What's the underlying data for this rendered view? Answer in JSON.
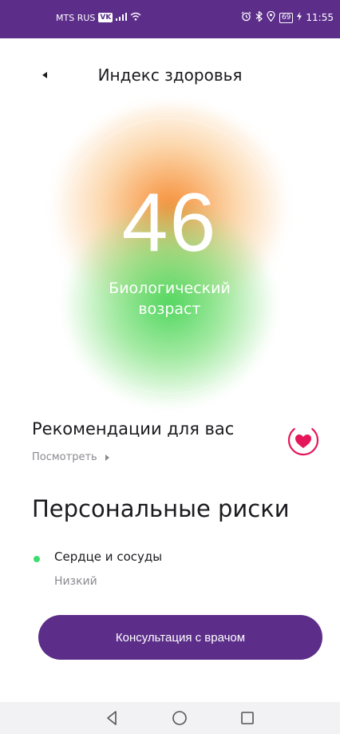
{
  "status_bar": {
    "carrier": "MTS RUS",
    "app_badge": "VK",
    "signal_icon": "signal-icon",
    "wifi_icon": "wifi-icon",
    "alarm_icon": "alarm-icon",
    "bluetooth_icon": "bluetooth-icon",
    "location_icon": "location-icon",
    "battery": "69",
    "time": "11:55"
  },
  "header": {
    "title": "Индекс здоровья",
    "back_icon": "back-arrow-icon"
  },
  "bio_age": {
    "value": "46",
    "label_line1": "Биологический",
    "label_line2": "возраст"
  },
  "recommendations": {
    "title": "Рекомендации для вас",
    "link": "Посмотреть",
    "icon": "heart-icon"
  },
  "risks": {
    "title": "Персональные риски",
    "items": [
      {
        "name": "Сердце и сосуды",
        "level": "Низкий",
        "status_color": "#3ddc6e"
      }
    ]
  },
  "cta": {
    "label": "Консультация с врачом"
  },
  "nav": {
    "back": "nav-back-icon",
    "home": "nav-home-icon",
    "recents": "nav-recents-icon"
  },
  "colors": {
    "brand": "#5c2e8a",
    "accent": "#e5175a",
    "low_risk": "#3ddc6e"
  }
}
